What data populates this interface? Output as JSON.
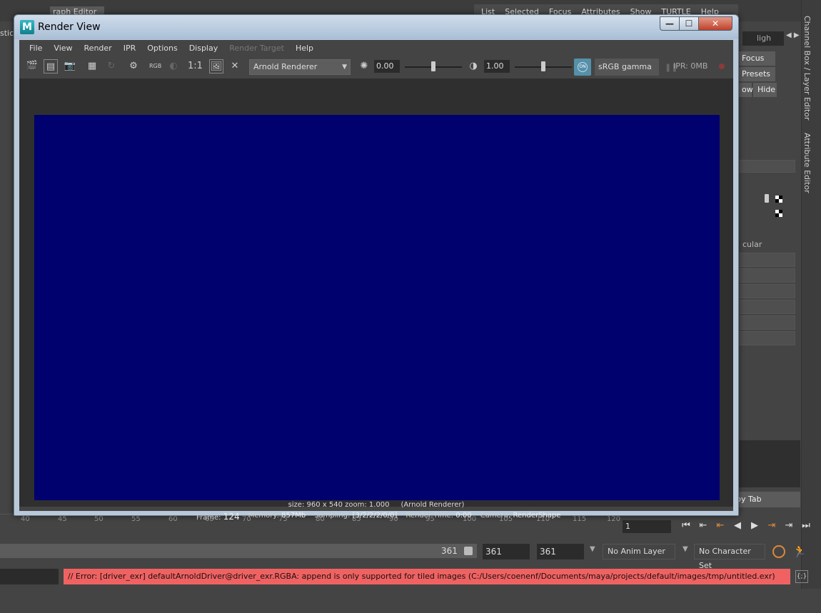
{
  "background": {
    "graph_editor_tab": "raph Editor",
    "top_menu": [
      "List",
      "Selected",
      "Focus",
      "Attributes",
      "Show",
      "TURTLE",
      "Help"
    ],
    "left_partial_label": "stics",
    "right_panel": {
      "search_text": "ligh",
      "focus_label": "Focus",
      "presets_label": "Presets",
      "show_partial": "ow",
      "hide_label": "Hide",
      "specular_partial": "cular",
      "copy_tab_label": "py Tab"
    },
    "vertical_tabs": {
      "channel_box": "Channel Box / Layer Editor",
      "attribute_editor": "Attribute Editor"
    },
    "timeline": {
      "ticks": [
        "40",
        "45",
        "50",
        "55",
        "60",
        "65",
        "70",
        "75",
        "80",
        "85",
        "90",
        "95",
        "100",
        "105",
        "110",
        "115",
        "120"
      ],
      "current_frame": "1"
    },
    "range": {
      "end_label": "361",
      "field_a": "361",
      "field_b": "361",
      "anim_layer": "No Anim Layer",
      "character_set": "No Character Set"
    },
    "error_message": "// Error: [driver_exr] defaultArnoldDriver@driver_exr.RGBA: append is only supported for tiled images (C:/Users/coenenf/Documents/maya/projects/default/images/tmp/untitled.exr)",
    "colors": {
      "error_bg": "#f06262",
      "render_image_bg": "#00006f",
      "maya_bg": "#444444"
    }
  },
  "render_view": {
    "app_icon": "M",
    "title": "Render View",
    "window_controls": {
      "minimize": "—",
      "maximize": "☐",
      "close": "✕"
    },
    "menu": [
      "File",
      "View",
      "Render",
      "IPR",
      "Options",
      "Display",
      "Render Target",
      "Help"
    ],
    "disabled_menu": "Render Target",
    "toolbar": {
      "rgb_label": "RGB",
      "one_to_one_label": "1:1",
      "renderer": "Arnold Renderer",
      "exposure": "0.00",
      "gamma": "1.00",
      "cm_label": "ON",
      "colorspace": "sRGB gamma",
      "ipr_memory": "IPR: 0MB"
    },
    "status": {
      "size_line": "size: 960 x 540 zoom: 1.000",
      "renderer_line": "(Arnold Renderer)",
      "frame_label": "Frame:",
      "frame_value": "124",
      "memory_label": "Memory:",
      "memory_value": "857Mb",
      "sampling_label": "Sampling:",
      "sampling_value": "[3/2/2/2/0/0]",
      "render_time_label": "Render Time:",
      "render_time_value": "0:00",
      "camera_label": "Camera:",
      "camera_value": "RenderShape"
    }
  }
}
